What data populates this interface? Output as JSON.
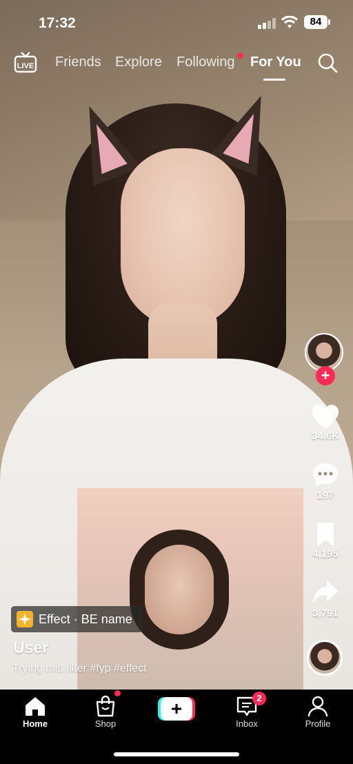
{
  "status_bar": {
    "time": "17:32",
    "battery": "84"
  },
  "top_nav": {
    "tabs": [
      {
        "label": "Friends"
      },
      {
        "label": "Explore"
      },
      {
        "label": "Following"
      },
      {
        "label": "For You"
      }
    ],
    "active_tab": "For You",
    "live_icon": "live-icon",
    "search_icon": "search-icon"
  },
  "rail": {
    "likes": "34.6K",
    "comments": "197",
    "saves": "4,195",
    "shares": "3,791"
  },
  "post": {
    "effect_label": "Effect · BE name",
    "username": "User",
    "caption": "Trying this filter #fyp #effect"
  },
  "tab_bar": {
    "home": "Home",
    "shop": "Shop",
    "inbox": "Inbox",
    "inbox_badge": "2",
    "profile": "Profile"
  },
  "colors": {
    "accent": "#fe2c55",
    "cyan": "#25f4ee",
    "effect_icon": "#f3b32a"
  }
}
